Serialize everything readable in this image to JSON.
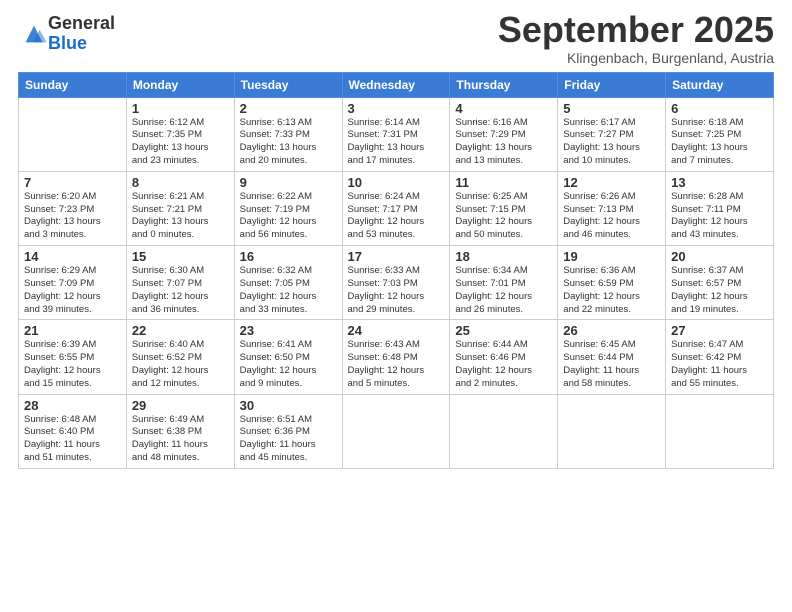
{
  "logo": {
    "general": "General",
    "blue": "Blue"
  },
  "title": "September 2025",
  "subtitle": "Klingenbach, Burgenland, Austria",
  "days_of_week": [
    "Sunday",
    "Monday",
    "Tuesday",
    "Wednesday",
    "Thursday",
    "Friday",
    "Saturday"
  ],
  "weeks": [
    [
      {
        "day": "",
        "info": ""
      },
      {
        "day": "1",
        "info": "Sunrise: 6:12 AM\nSunset: 7:35 PM\nDaylight: 13 hours\nand 23 minutes."
      },
      {
        "day": "2",
        "info": "Sunrise: 6:13 AM\nSunset: 7:33 PM\nDaylight: 13 hours\nand 20 minutes."
      },
      {
        "day": "3",
        "info": "Sunrise: 6:14 AM\nSunset: 7:31 PM\nDaylight: 13 hours\nand 17 minutes."
      },
      {
        "day": "4",
        "info": "Sunrise: 6:16 AM\nSunset: 7:29 PM\nDaylight: 13 hours\nand 13 minutes."
      },
      {
        "day": "5",
        "info": "Sunrise: 6:17 AM\nSunset: 7:27 PM\nDaylight: 13 hours\nand 10 minutes."
      },
      {
        "day": "6",
        "info": "Sunrise: 6:18 AM\nSunset: 7:25 PM\nDaylight: 13 hours\nand 7 minutes."
      }
    ],
    [
      {
        "day": "7",
        "info": "Sunrise: 6:20 AM\nSunset: 7:23 PM\nDaylight: 13 hours\nand 3 minutes."
      },
      {
        "day": "8",
        "info": "Sunrise: 6:21 AM\nSunset: 7:21 PM\nDaylight: 13 hours\nand 0 minutes."
      },
      {
        "day": "9",
        "info": "Sunrise: 6:22 AM\nSunset: 7:19 PM\nDaylight: 12 hours\nand 56 minutes."
      },
      {
        "day": "10",
        "info": "Sunrise: 6:24 AM\nSunset: 7:17 PM\nDaylight: 12 hours\nand 53 minutes."
      },
      {
        "day": "11",
        "info": "Sunrise: 6:25 AM\nSunset: 7:15 PM\nDaylight: 12 hours\nand 50 minutes."
      },
      {
        "day": "12",
        "info": "Sunrise: 6:26 AM\nSunset: 7:13 PM\nDaylight: 12 hours\nand 46 minutes."
      },
      {
        "day": "13",
        "info": "Sunrise: 6:28 AM\nSunset: 7:11 PM\nDaylight: 12 hours\nand 43 minutes."
      }
    ],
    [
      {
        "day": "14",
        "info": "Sunrise: 6:29 AM\nSunset: 7:09 PM\nDaylight: 12 hours\nand 39 minutes."
      },
      {
        "day": "15",
        "info": "Sunrise: 6:30 AM\nSunset: 7:07 PM\nDaylight: 12 hours\nand 36 minutes."
      },
      {
        "day": "16",
        "info": "Sunrise: 6:32 AM\nSunset: 7:05 PM\nDaylight: 12 hours\nand 33 minutes."
      },
      {
        "day": "17",
        "info": "Sunrise: 6:33 AM\nSunset: 7:03 PM\nDaylight: 12 hours\nand 29 minutes."
      },
      {
        "day": "18",
        "info": "Sunrise: 6:34 AM\nSunset: 7:01 PM\nDaylight: 12 hours\nand 26 minutes."
      },
      {
        "day": "19",
        "info": "Sunrise: 6:36 AM\nSunset: 6:59 PM\nDaylight: 12 hours\nand 22 minutes."
      },
      {
        "day": "20",
        "info": "Sunrise: 6:37 AM\nSunset: 6:57 PM\nDaylight: 12 hours\nand 19 minutes."
      }
    ],
    [
      {
        "day": "21",
        "info": "Sunrise: 6:39 AM\nSunset: 6:55 PM\nDaylight: 12 hours\nand 15 minutes."
      },
      {
        "day": "22",
        "info": "Sunrise: 6:40 AM\nSunset: 6:52 PM\nDaylight: 12 hours\nand 12 minutes."
      },
      {
        "day": "23",
        "info": "Sunrise: 6:41 AM\nSunset: 6:50 PM\nDaylight: 12 hours\nand 9 minutes."
      },
      {
        "day": "24",
        "info": "Sunrise: 6:43 AM\nSunset: 6:48 PM\nDaylight: 12 hours\nand 5 minutes."
      },
      {
        "day": "25",
        "info": "Sunrise: 6:44 AM\nSunset: 6:46 PM\nDaylight: 12 hours\nand 2 minutes."
      },
      {
        "day": "26",
        "info": "Sunrise: 6:45 AM\nSunset: 6:44 PM\nDaylight: 11 hours\nand 58 minutes."
      },
      {
        "day": "27",
        "info": "Sunrise: 6:47 AM\nSunset: 6:42 PM\nDaylight: 11 hours\nand 55 minutes."
      }
    ],
    [
      {
        "day": "28",
        "info": "Sunrise: 6:48 AM\nSunset: 6:40 PM\nDaylight: 11 hours\nand 51 minutes."
      },
      {
        "day": "29",
        "info": "Sunrise: 6:49 AM\nSunset: 6:38 PM\nDaylight: 11 hours\nand 48 minutes."
      },
      {
        "day": "30",
        "info": "Sunrise: 6:51 AM\nSunset: 6:36 PM\nDaylight: 11 hours\nand 45 minutes."
      },
      {
        "day": "",
        "info": ""
      },
      {
        "day": "",
        "info": ""
      },
      {
        "day": "",
        "info": ""
      },
      {
        "day": "",
        "info": ""
      }
    ]
  ]
}
